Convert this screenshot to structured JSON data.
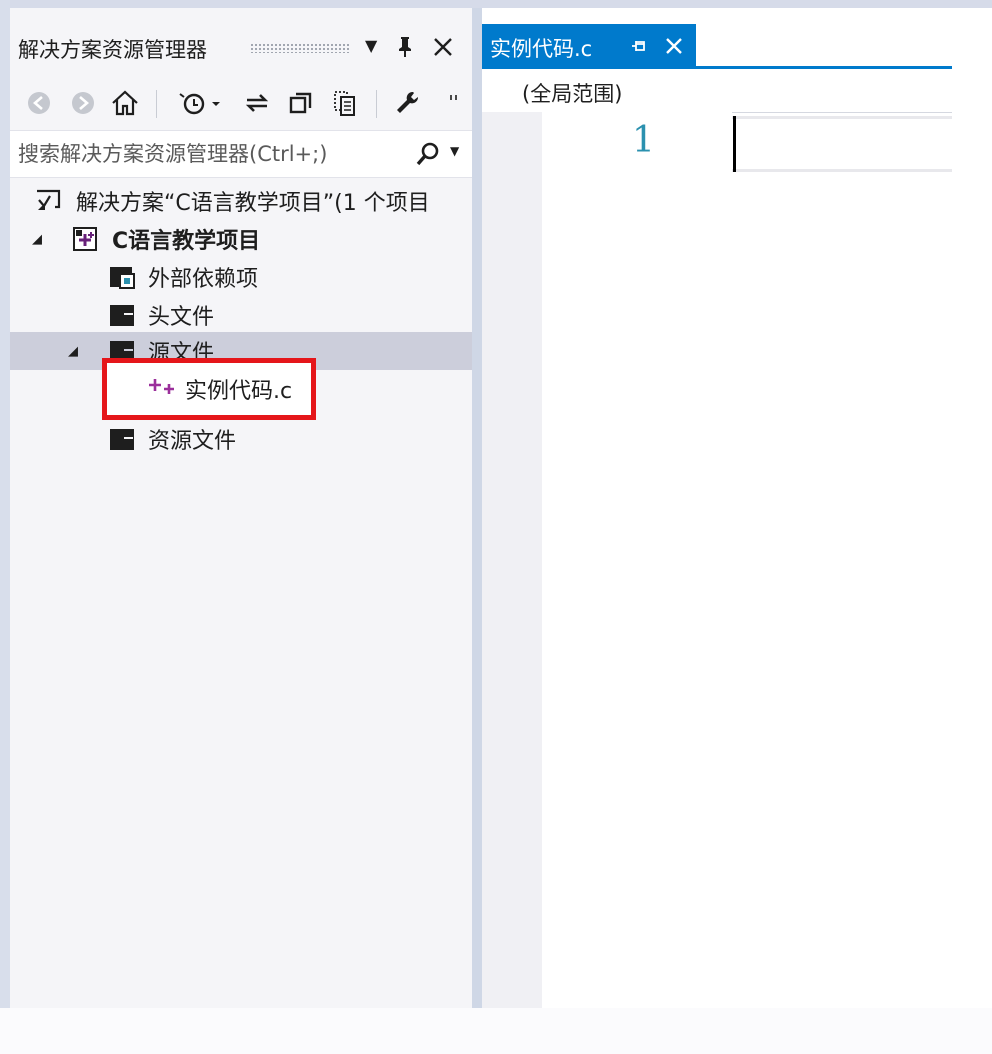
{
  "explorer": {
    "title": "解决方案资源管理器",
    "search_placeholder": "搜索解决方案资源管理器(Ctrl+;)",
    "tree": {
      "solution": "解决方案“C语言教学项目”(1 个项目",
      "project": "C语言教学项目",
      "external_deps": "外部依赖项",
      "header_files": "头文件",
      "source_files": "源文件",
      "source_file_item": "实例代码.c",
      "resource_files": "资源文件"
    }
  },
  "editor": {
    "tab_label": "实例代码.c",
    "scope": "(全局范围)",
    "line_number": "1"
  },
  "colors": {
    "accent": "#007acc",
    "highlight": "#e5161a",
    "line_number": "#2b91af",
    "selected_row": "#cccedb"
  }
}
